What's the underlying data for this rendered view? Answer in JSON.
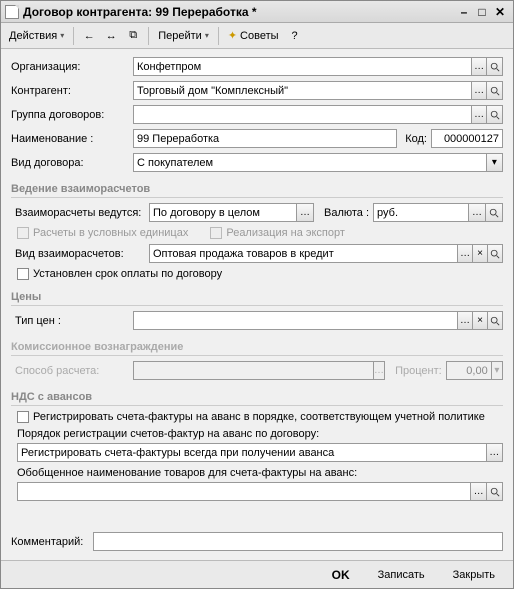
{
  "window": {
    "title": "Договор контрагента: 99 Переработка *"
  },
  "toolbar": {
    "actions": "Действия",
    "go": "Перейти",
    "tips": "Советы"
  },
  "fields": {
    "org_label": "Организация:",
    "org_value": "Конфетпром",
    "contr_label": "Контрагент:",
    "contr_value": "Торговый дом \"Комплексный\"",
    "group_label": "Группа договоров:",
    "group_value": "",
    "name_label": "Наименование :",
    "name_value": "99 Переработка",
    "code_label": "Код:",
    "code_value": "000000127",
    "type_label": "Вид договора:",
    "type_value": "С покупателем"
  },
  "sect1": {
    "title": "Ведение взаиморасчетов",
    "settl_label": "Взаиморасчеты ведутся:",
    "settl_value": "По договору в целом",
    "currency_label": "Валюта :",
    "currency_value": "руб.",
    "chk_units": "Расчеты в условных единицах",
    "chk_export": "Реализация на экспорт",
    "type2_label": "Вид взаиморасчетов:",
    "type2_value": "Оптовая продажа товаров в кредит",
    "chk_payterm": "Установлен срок оплаты по договору"
  },
  "sect2": {
    "title": "Цены",
    "price_type_label": "Тип цен :",
    "price_type_value": ""
  },
  "sect3": {
    "title": "Комиссионное вознаграждение",
    "method_label": "Способ расчета:",
    "method_value": "",
    "percent_label": "Процент:",
    "percent_value": "0,00"
  },
  "sect4": {
    "title": "НДС с авансов",
    "chk_reg": "Регистрировать счета-фактуры на аванс в порядке, соответствующем учетной политике",
    "order_label": "Порядок регистрации счетов-фактур на аванс по договору:",
    "order_value": "Регистрировать счета-фактуры всегда при получении аванса",
    "general_label": "Обобщенное наименование товаров для счета-фактуры на аванс:",
    "general_value": ""
  },
  "comment": {
    "label": "Комментарий:",
    "value": ""
  },
  "footer": {
    "ok": "OK",
    "save": "Записать",
    "close": "Закрыть"
  }
}
